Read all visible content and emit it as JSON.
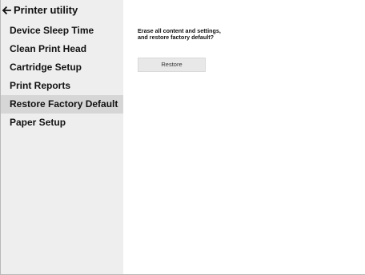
{
  "window": {
    "title": "Printer utility",
    "back_icon": "arrow-left-icon"
  },
  "sidebar": {
    "items": [
      {
        "label": "Device Sleep Time",
        "selected": false
      },
      {
        "label": "Clean Print Head",
        "selected": false
      },
      {
        "label": "Cartridge Setup",
        "selected": false
      },
      {
        "label": "Print Reports",
        "selected": false
      },
      {
        "label": "Restore Factory Default",
        "selected": true
      },
      {
        "label": "Paper Setup",
        "selected": false
      }
    ]
  },
  "main": {
    "message": "Erase all content and settings,\nand restore factory default?",
    "button_label": "Restore"
  },
  "colors": {
    "sidebar_background": "#eeeeee",
    "selected_item_background": "#d6d6d6",
    "content_background": "#ffffff",
    "button_background": "#e8e8e8",
    "text": "#111111"
  }
}
